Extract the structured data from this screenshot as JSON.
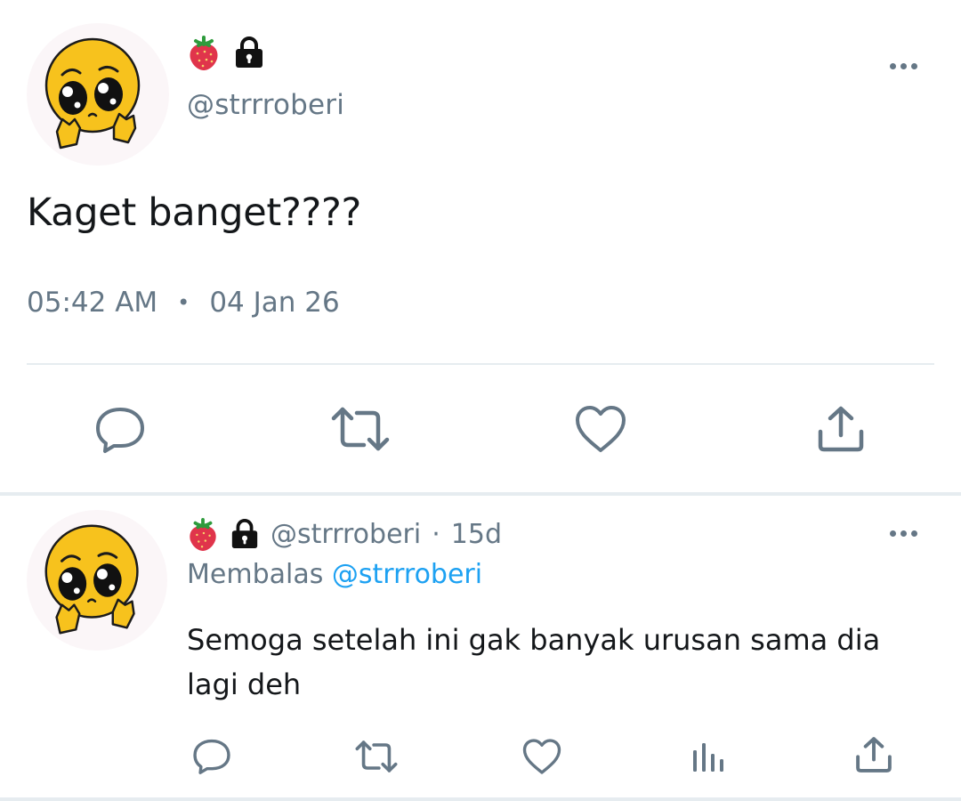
{
  "main_tweet": {
    "emojis": [
      "strawberry-icon",
      "lock-icon"
    ],
    "handle": "@strrroberi",
    "text": "Kaget banget????",
    "time": "05:42 AM",
    "separator": "•",
    "date": "04 Jan 26",
    "actions": [
      "reply-icon",
      "retweet-icon",
      "like-icon",
      "share-icon"
    ]
  },
  "reply": {
    "emojis": [
      "strawberry-icon",
      "lock-icon"
    ],
    "handle": "@strrroberi",
    "separator": "·",
    "age": "15d",
    "replying_prefix": "Membalas",
    "replying_to": "@strrroberi",
    "text": "Semoga setelah ini gak banyak urusan sama dia lagi deh",
    "actions": [
      "reply-icon",
      "retweet-icon",
      "like-icon",
      "analytics-icon",
      "share-icon"
    ]
  },
  "colors": {
    "text": "#14171a",
    "secondary": "#657786",
    "link": "#1da1f2",
    "divider": "#e6ecf0",
    "avatar_face": "#f7c21d",
    "strawberry": "#e0344b"
  }
}
